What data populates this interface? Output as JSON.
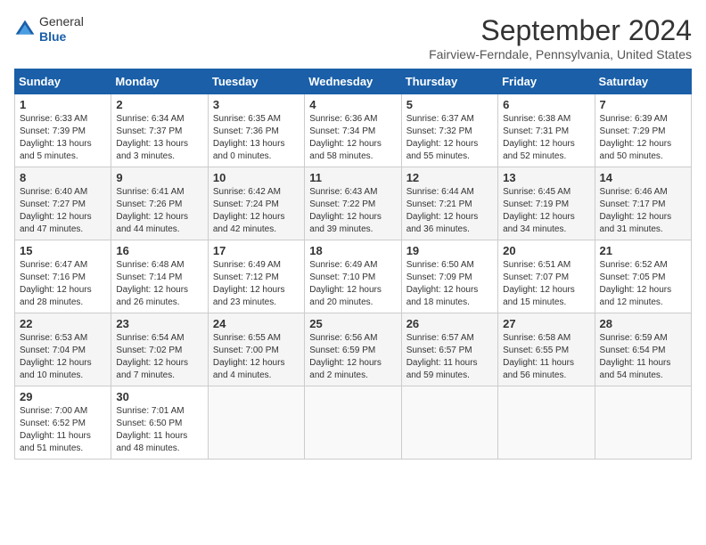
{
  "header": {
    "logo_line1": "General",
    "logo_line2": "Blue",
    "month_title": "September 2024",
    "location": "Fairview-Ferndale, Pennsylvania, United States"
  },
  "days_of_week": [
    "Sunday",
    "Monday",
    "Tuesday",
    "Wednesday",
    "Thursday",
    "Friday",
    "Saturday"
  ],
  "weeks": [
    [
      {
        "day": "1",
        "info": "Sunrise: 6:33 AM\nSunset: 7:39 PM\nDaylight: 13 hours\nand 5 minutes."
      },
      {
        "day": "2",
        "info": "Sunrise: 6:34 AM\nSunset: 7:37 PM\nDaylight: 13 hours\nand 3 minutes."
      },
      {
        "day": "3",
        "info": "Sunrise: 6:35 AM\nSunset: 7:36 PM\nDaylight: 13 hours\nand 0 minutes."
      },
      {
        "day": "4",
        "info": "Sunrise: 6:36 AM\nSunset: 7:34 PM\nDaylight: 12 hours\nand 58 minutes."
      },
      {
        "day": "5",
        "info": "Sunrise: 6:37 AM\nSunset: 7:32 PM\nDaylight: 12 hours\nand 55 minutes."
      },
      {
        "day": "6",
        "info": "Sunrise: 6:38 AM\nSunset: 7:31 PM\nDaylight: 12 hours\nand 52 minutes."
      },
      {
        "day": "7",
        "info": "Sunrise: 6:39 AM\nSunset: 7:29 PM\nDaylight: 12 hours\nand 50 minutes."
      }
    ],
    [
      {
        "day": "8",
        "info": "Sunrise: 6:40 AM\nSunset: 7:27 PM\nDaylight: 12 hours\nand 47 minutes."
      },
      {
        "day": "9",
        "info": "Sunrise: 6:41 AM\nSunset: 7:26 PM\nDaylight: 12 hours\nand 44 minutes."
      },
      {
        "day": "10",
        "info": "Sunrise: 6:42 AM\nSunset: 7:24 PM\nDaylight: 12 hours\nand 42 minutes."
      },
      {
        "day": "11",
        "info": "Sunrise: 6:43 AM\nSunset: 7:22 PM\nDaylight: 12 hours\nand 39 minutes."
      },
      {
        "day": "12",
        "info": "Sunrise: 6:44 AM\nSunset: 7:21 PM\nDaylight: 12 hours\nand 36 minutes."
      },
      {
        "day": "13",
        "info": "Sunrise: 6:45 AM\nSunset: 7:19 PM\nDaylight: 12 hours\nand 34 minutes."
      },
      {
        "day": "14",
        "info": "Sunrise: 6:46 AM\nSunset: 7:17 PM\nDaylight: 12 hours\nand 31 minutes."
      }
    ],
    [
      {
        "day": "15",
        "info": "Sunrise: 6:47 AM\nSunset: 7:16 PM\nDaylight: 12 hours\nand 28 minutes."
      },
      {
        "day": "16",
        "info": "Sunrise: 6:48 AM\nSunset: 7:14 PM\nDaylight: 12 hours\nand 26 minutes."
      },
      {
        "day": "17",
        "info": "Sunrise: 6:49 AM\nSunset: 7:12 PM\nDaylight: 12 hours\nand 23 minutes."
      },
      {
        "day": "18",
        "info": "Sunrise: 6:49 AM\nSunset: 7:10 PM\nDaylight: 12 hours\nand 20 minutes."
      },
      {
        "day": "19",
        "info": "Sunrise: 6:50 AM\nSunset: 7:09 PM\nDaylight: 12 hours\nand 18 minutes."
      },
      {
        "day": "20",
        "info": "Sunrise: 6:51 AM\nSunset: 7:07 PM\nDaylight: 12 hours\nand 15 minutes."
      },
      {
        "day": "21",
        "info": "Sunrise: 6:52 AM\nSunset: 7:05 PM\nDaylight: 12 hours\nand 12 minutes."
      }
    ],
    [
      {
        "day": "22",
        "info": "Sunrise: 6:53 AM\nSunset: 7:04 PM\nDaylight: 12 hours\nand 10 minutes."
      },
      {
        "day": "23",
        "info": "Sunrise: 6:54 AM\nSunset: 7:02 PM\nDaylight: 12 hours\nand 7 minutes."
      },
      {
        "day": "24",
        "info": "Sunrise: 6:55 AM\nSunset: 7:00 PM\nDaylight: 12 hours\nand 4 minutes."
      },
      {
        "day": "25",
        "info": "Sunrise: 6:56 AM\nSunset: 6:59 PM\nDaylight: 12 hours\nand 2 minutes."
      },
      {
        "day": "26",
        "info": "Sunrise: 6:57 AM\nSunset: 6:57 PM\nDaylight: 11 hours\nand 59 minutes."
      },
      {
        "day": "27",
        "info": "Sunrise: 6:58 AM\nSunset: 6:55 PM\nDaylight: 11 hours\nand 56 minutes."
      },
      {
        "day": "28",
        "info": "Sunrise: 6:59 AM\nSunset: 6:54 PM\nDaylight: 11 hours\nand 54 minutes."
      }
    ],
    [
      {
        "day": "29",
        "info": "Sunrise: 7:00 AM\nSunset: 6:52 PM\nDaylight: 11 hours\nand 51 minutes."
      },
      {
        "day": "30",
        "info": "Sunrise: 7:01 AM\nSunset: 6:50 PM\nDaylight: 11 hours\nand 48 minutes."
      },
      {
        "day": "",
        "info": ""
      },
      {
        "day": "",
        "info": ""
      },
      {
        "day": "",
        "info": ""
      },
      {
        "day": "",
        "info": ""
      },
      {
        "day": "",
        "info": ""
      }
    ]
  ]
}
